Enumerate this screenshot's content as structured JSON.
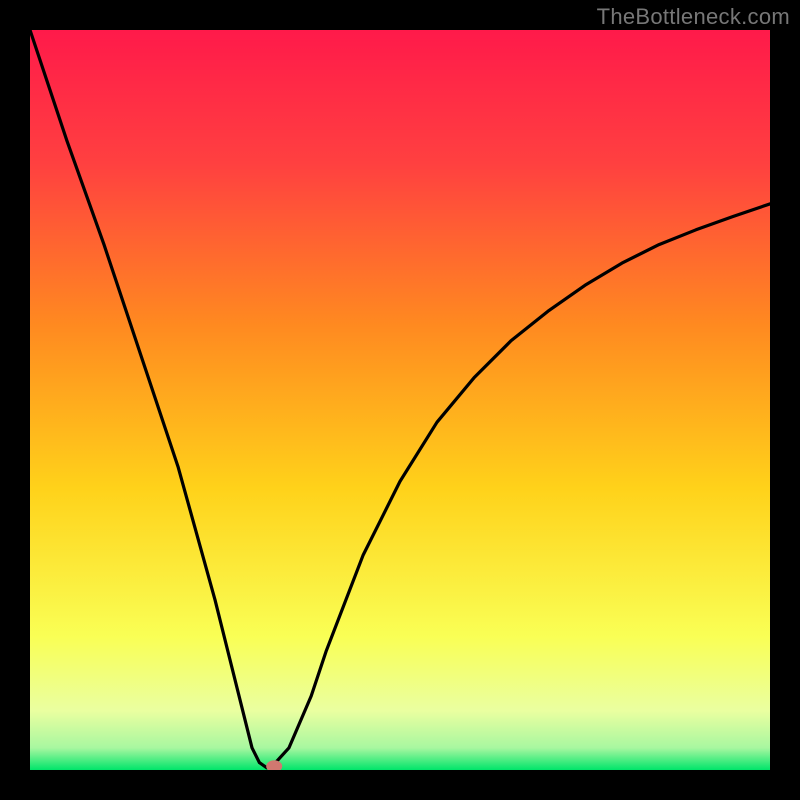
{
  "watermark": "TheBottleneck.com",
  "chart_data": {
    "type": "line",
    "title": "",
    "xlabel": "",
    "ylabel": "",
    "xlim": [
      0,
      100
    ],
    "ylim": [
      0,
      100
    ],
    "grid": false,
    "background_gradient": {
      "top_color": "#ff1a4a",
      "mid_colors": [
        "#ff6a2a",
        "#ffd21a",
        "#f9ff55"
      ],
      "bottom_color": "#00e56a"
    },
    "series": [
      {
        "name": "curve",
        "x": [
          0,
          5,
          10,
          15,
          20,
          25,
          27,
          29,
          30,
          31,
          32,
          33,
          35,
          38,
          40,
          45,
          50,
          55,
          60,
          65,
          70,
          75,
          80,
          85,
          90,
          95,
          100
        ],
        "y": [
          100,
          85,
          71,
          56,
          41,
          23,
          15,
          7,
          3,
          1,
          0.3,
          0.8,
          3,
          10,
          16,
          29,
          39,
          47,
          53,
          58,
          62,
          65.5,
          68.5,
          71,
          73,
          74.8,
          76.5
        ]
      }
    ],
    "marker": {
      "x": 33,
      "y": 0.5,
      "color": "#d07870"
    },
    "colors": {
      "curve_stroke": "#000000",
      "marker_fill": "#d07870",
      "frame_bg": "#000000"
    }
  }
}
